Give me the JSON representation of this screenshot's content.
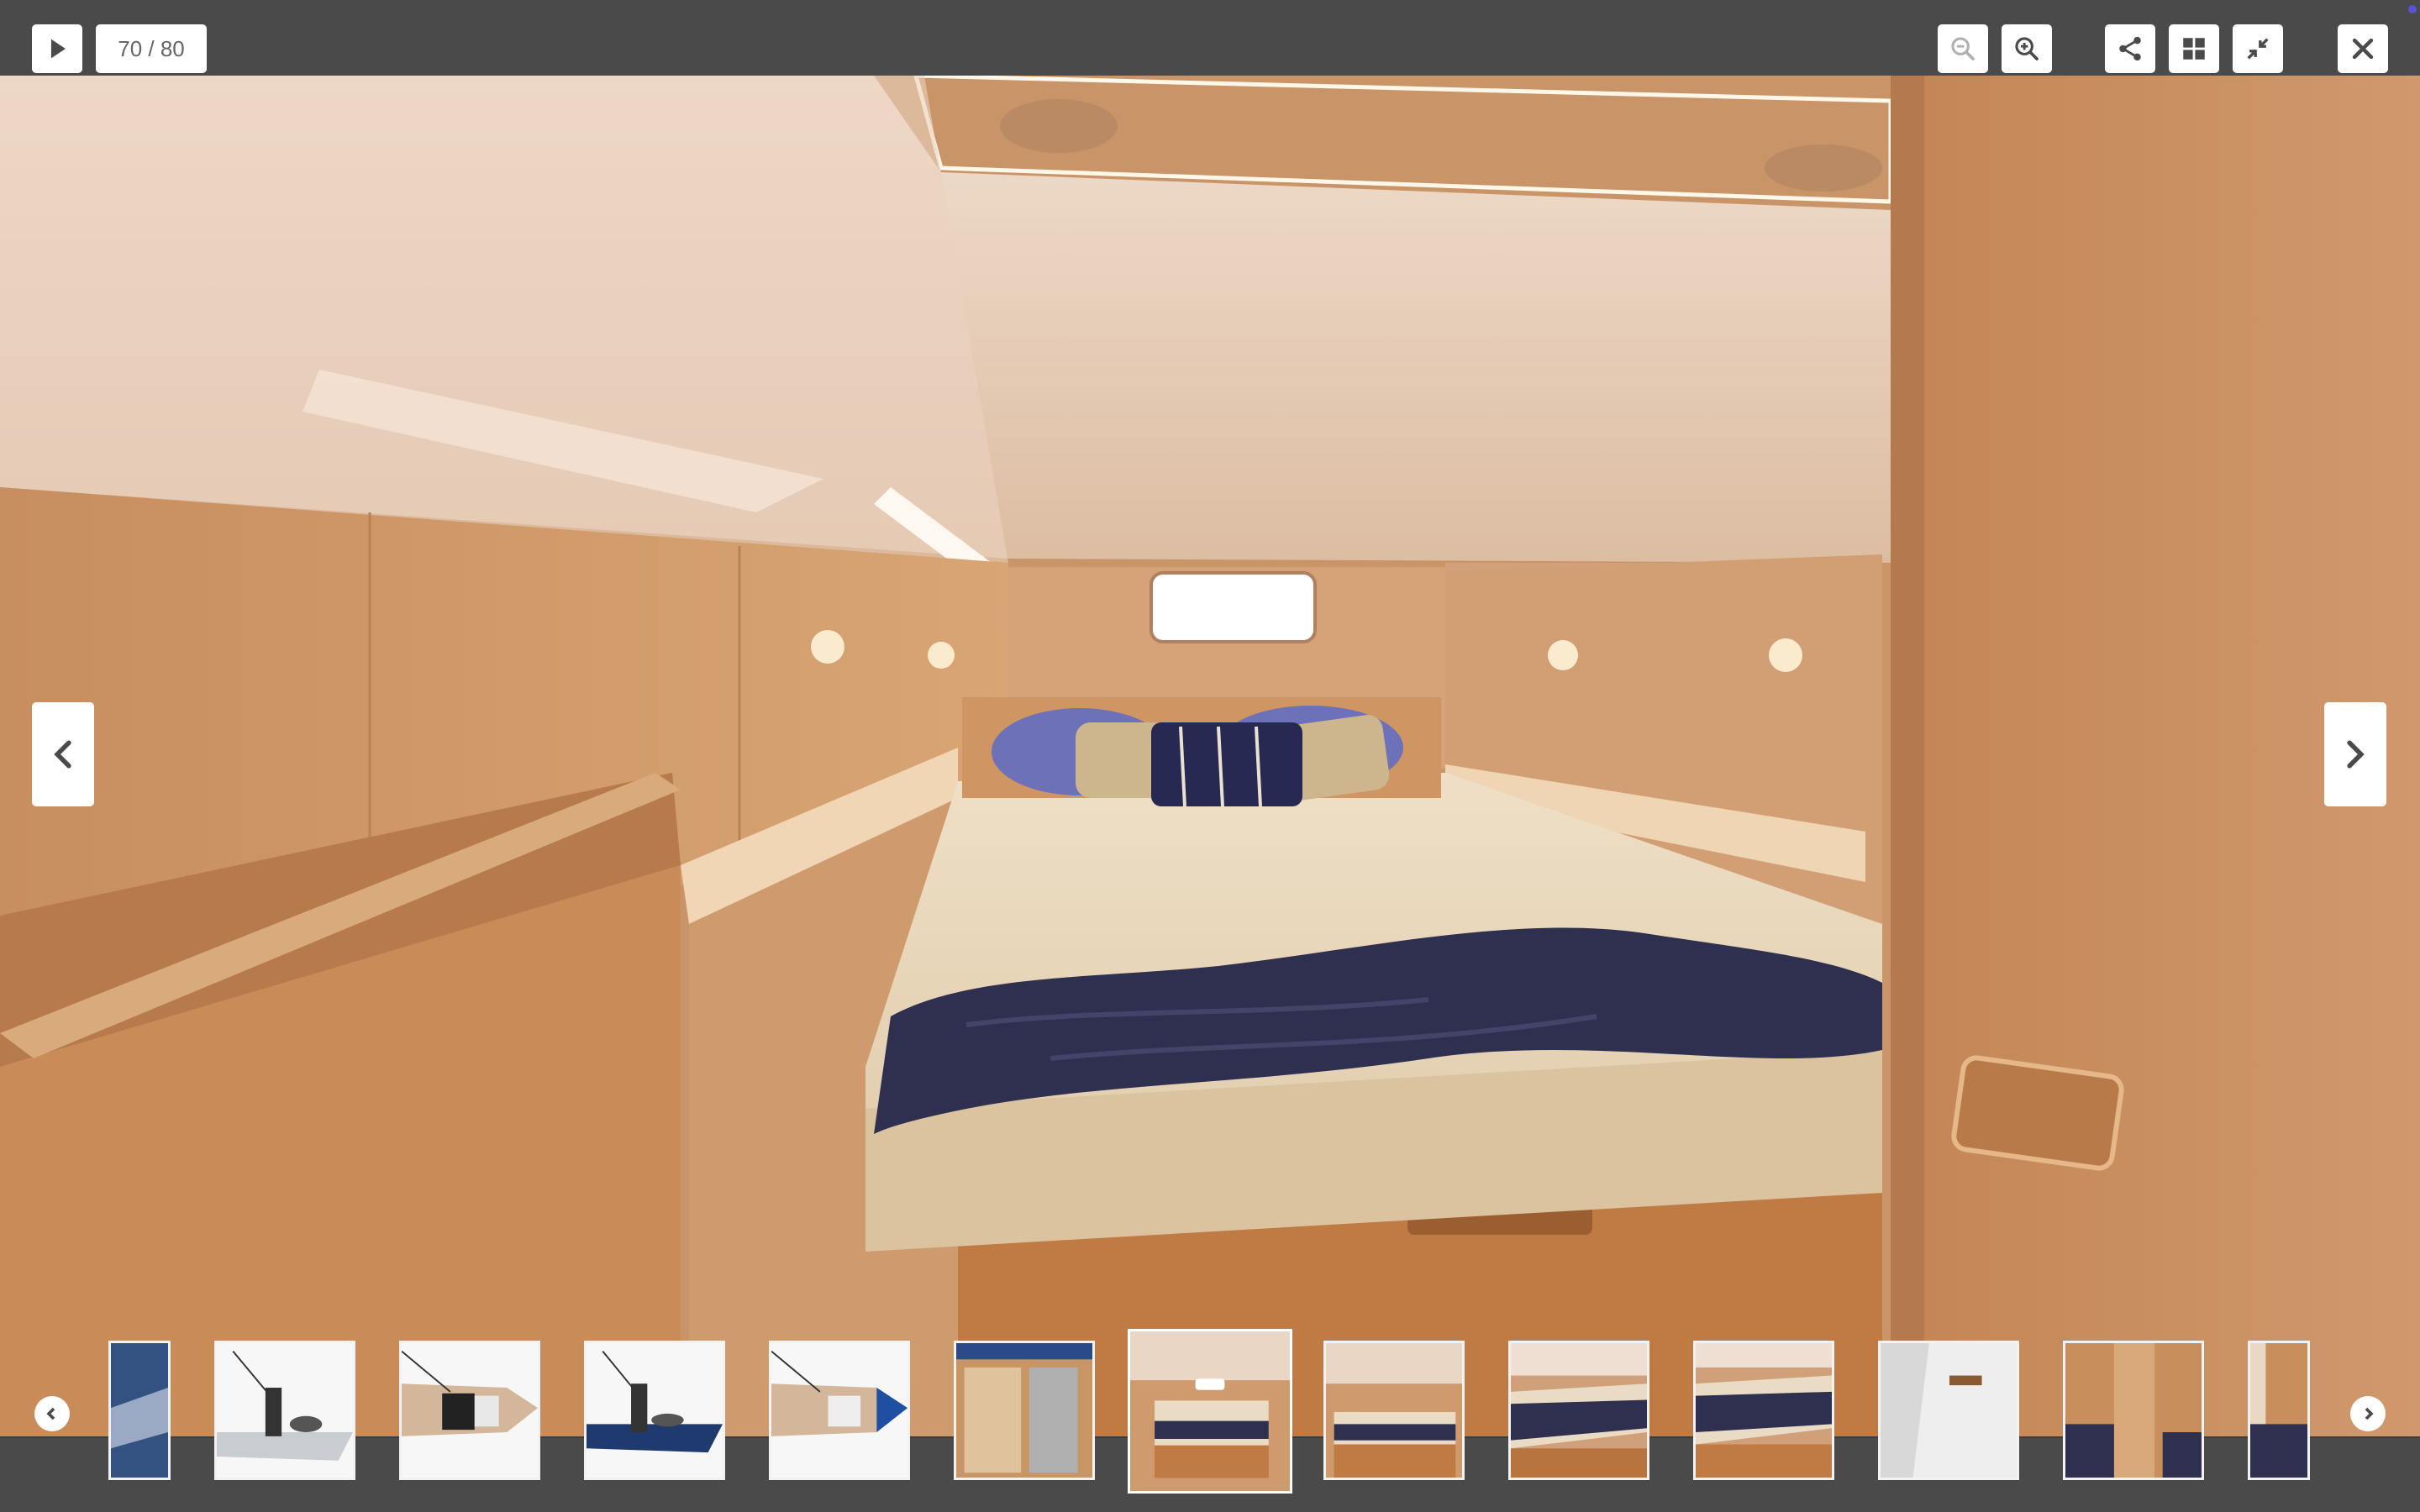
{
  "toolbar": {
    "play_icon": "play-icon",
    "counter": "70 / 80",
    "zoom_out_icon": "zoom-out-icon",
    "zoom_in_icon": "zoom-in-icon",
    "share_icon": "share-icon",
    "grid_icon": "grid-icon",
    "exit_fullscreen_icon": "collapse-icon",
    "close_icon": "close-icon"
  },
  "colors": {
    "toolbar_bg": "#4a4a4b",
    "button_bg": "#ffffff",
    "icon": "#4a4a4b",
    "wood": "#c88f5c",
    "ceiling": "#e9d3bf",
    "bedding": "#2f2f4f"
  },
  "main_image": {
    "subject": "yacht-cabin-bedroom",
    "prev_icon": "chevron-left-icon",
    "next_icon": "chevron-right-icon"
  },
  "thumbnails": {
    "prev_icon": "circle-chevron-left-icon",
    "next_icon": "circle-chevron-right-icon",
    "items": [
      {
        "kind": "boat-water",
        "active": false
      },
      {
        "kind": "boat-profile-grey",
        "active": false
      },
      {
        "kind": "boat-top-view-wood",
        "active": false
      },
      {
        "kind": "boat-profile-blue",
        "active": false
      },
      {
        "kind": "boat-top-view-blue",
        "active": false
      },
      {
        "kind": "cabin-storage",
        "active": false
      },
      {
        "kind": "cabin-bed-front",
        "active": true
      },
      {
        "kind": "cabin-bed-wide",
        "active": false
      },
      {
        "kind": "cabin-bed-side",
        "active": false
      },
      {
        "kind": "cabin-bed-angle",
        "active": false
      },
      {
        "kind": "cabin-door",
        "active": false
      },
      {
        "kind": "cabin-wardrobe",
        "active": false
      },
      {
        "kind": "cabin-partial",
        "active": false
      }
    ]
  }
}
